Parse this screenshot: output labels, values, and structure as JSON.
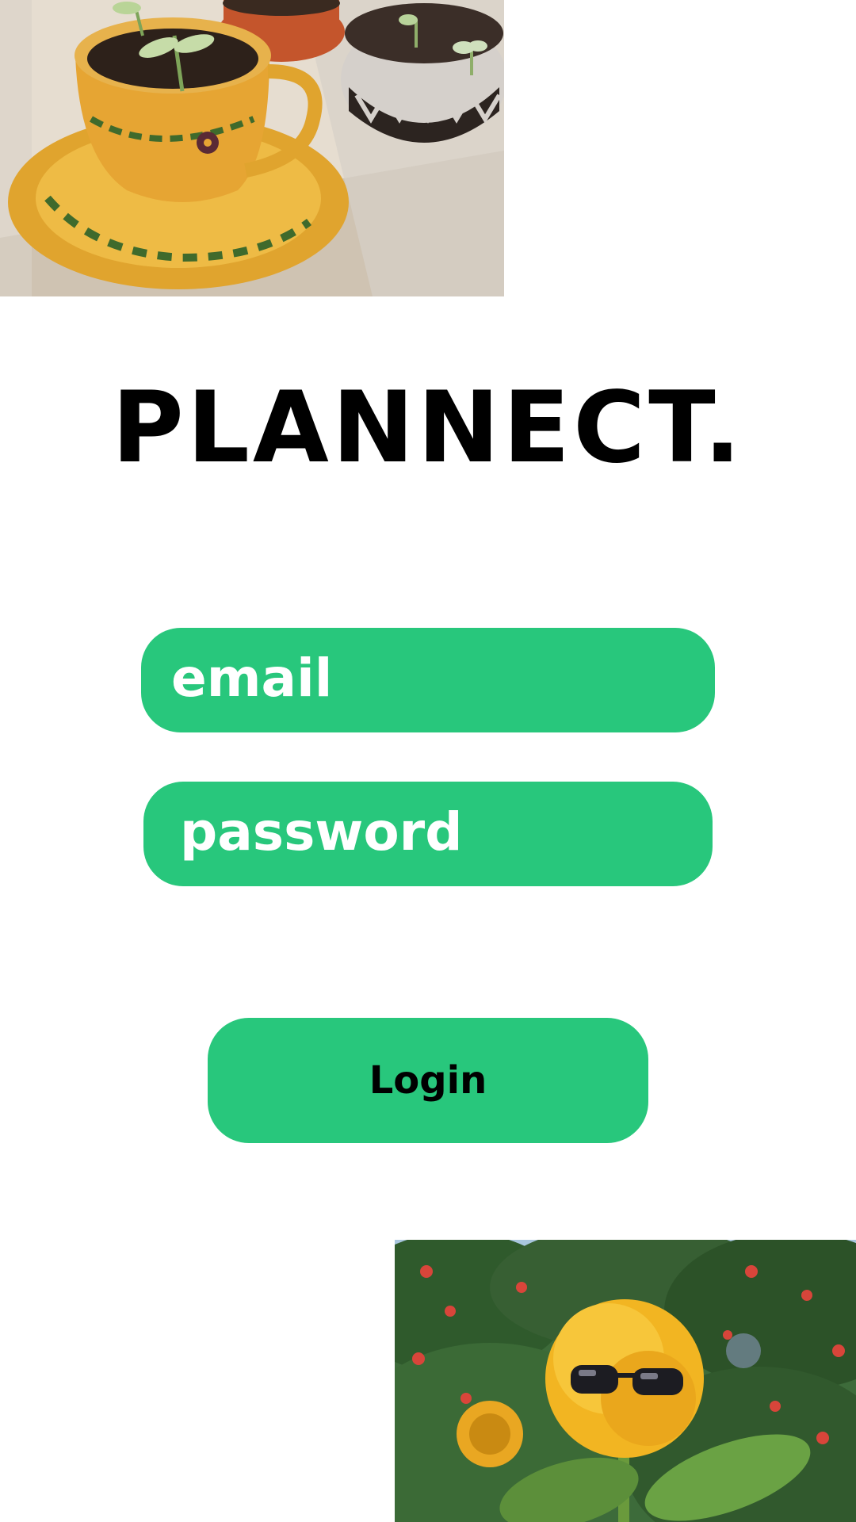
{
  "app": {
    "title": "PLANNECT."
  },
  "images": {
    "top": "seedlings-in-teacups-photo",
    "bottom": "sunflower-with-sunglasses-photo"
  },
  "form": {
    "email_placeholder": "email",
    "password_placeholder": "password",
    "login_label": "Login"
  },
  "colors": {
    "accent": "#28c77c",
    "background": "#ffffff",
    "title": "#000000",
    "field_text": "#ffffff",
    "button_text": "#000000"
  }
}
